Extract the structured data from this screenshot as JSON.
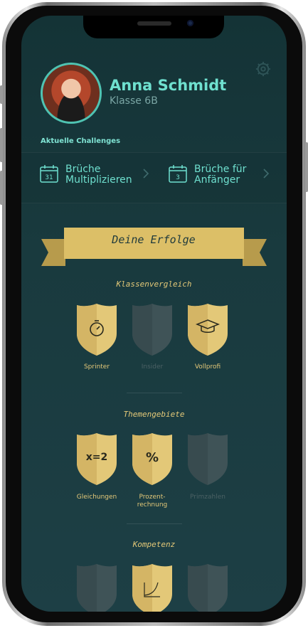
{
  "profile": {
    "name": "Anna Schmidt",
    "klasse": "Klasse 6B"
  },
  "icons": {
    "settings": "gear-icon",
    "calendar": "calendar-icon"
  },
  "challenges": {
    "title": "Aktuelle Challenges",
    "items": [
      {
        "day": "31",
        "line1": "Brüche",
        "line2": "Multiplizieren"
      },
      {
        "day": "3",
        "line1": "Brüche für",
        "line2": "Anfänger"
      }
    ]
  },
  "erfolge": {
    "title": "Deine Erfolge"
  },
  "sections": [
    {
      "title": "Klassenvergleich",
      "badges": [
        {
          "label": "Sprinter",
          "earned": true,
          "icon": "stopwatch-icon"
        },
        {
          "label": "Insider",
          "earned": false,
          "icon": ""
        },
        {
          "label": "Vollprofi",
          "earned": true,
          "icon": "graduation-cap-icon"
        }
      ]
    },
    {
      "title": "Themengebiete",
      "badges": [
        {
          "label": "Gleichungen",
          "earned": true,
          "icon_text": "x=2"
        },
        {
          "label_line1": "Prozent-",
          "label_line2": "rechnung",
          "earned": true,
          "icon_text": "%"
        },
        {
          "label": "Primzahlen",
          "earned": false,
          "icon_text": ""
        }
      ]
    },
    {
      "title": "Kompetenz",
      "badges": [
        {
          "label": "",
          "earned": false
        },
        {
          "label": "",
          "earned": true,
          "icon": "curve-icon"
        },
        {
          "label": "",
          "earned": false
        }
      ]
    }
  ],
  "colors": {
    "accent": "#6fe0cf",
    "gold": "#e3c878",
    "background": "#163538"
  }
}
